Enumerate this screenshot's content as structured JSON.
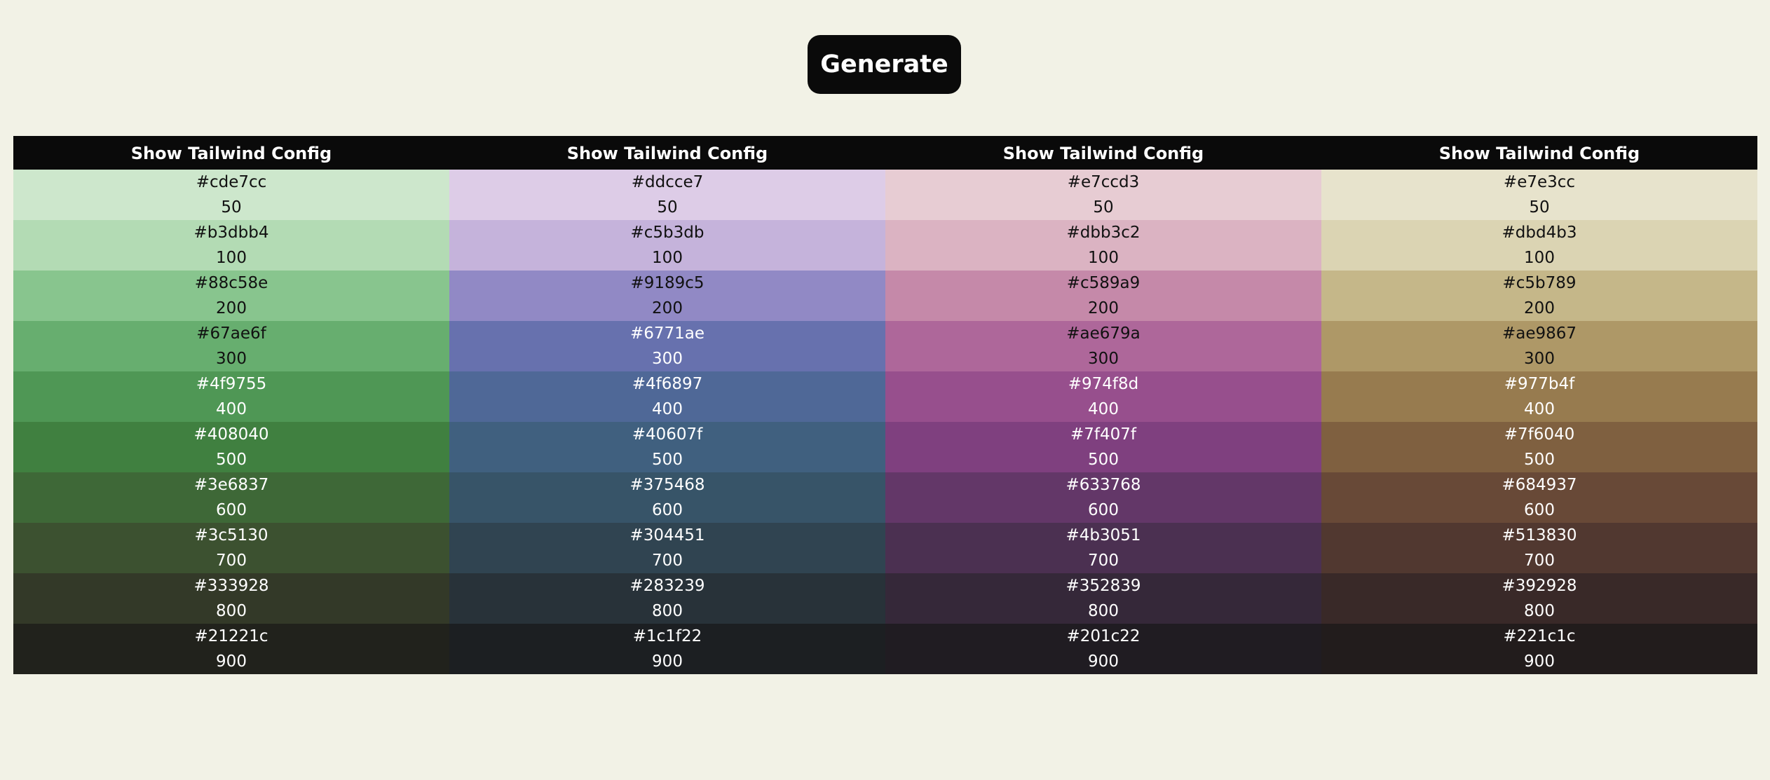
{
  "generate_label": "Generate",
  "palettes": [
    {
      "config_label": "Show Tailwind Config",
      "swatches": [
        {
          "hex": "#cde7cc",
          "shade": "50",
          "text": "#111111"
        },
        {
          "hex": "#b3dbb4",
          "shade": "100",
          "text": "#111111"
        },
        {
          "hex": "#88c58e",
          "shade": "200",
          "text": "#111111"
        },
        {
          "hex": "#67ae6f",
          "shade": "300",
          "text": "#111111"
        },
        {
          "hex": "#4f9755",
          "shade": "400",
          "text": "#ffffff"
        },
        {
          "hex": "#408040",
          "shade": "500",
          "text": "#ffffff"
        },
        {
          "hex": "#3e6837",
          "shade": "600",
          "text": "#ffffff"
        },
        {
          "hex": "#3c5130",
          "shade": "700",
          "text": "#ffffff"
        },
        {
          "hex": "#333928",
          "shade": "800",
          "text": "#ffffff"
        },
        {
          "hex": "#21221c",
          "shade": "900",
          "text": "#ffffff"
        }
      ]
    },
    {
      "config_label": "Show Tailwind Config",
      "swatches": [
        {
          "hex": "#ddcce7",
          "shade": "50",
          "text": "#111111"
        },
        {
          "hex": "#c5b3db",
          "shade": "100",
          "text": "#111111"
        },
        {
          "hex": "#9189c5",
          "shade": "200",
          "text": "#111111"
        },
        {
          "hex": "#6771ae",
          "shade": "300",
          "text": "#ffffff"
        },
        {
          "hex": "#4f6897",
          "shade": "400",
          "text": "#ffffff"
        },
        {
          "hex": "#40607f",
          "shade": "500",
          "text": "#ffffff"
        },
        {
          "hex": "#375468",
          "shade": "600",
          "text": "#ffffff"
        },
        {
          "hex": "#304451",
          "shade": "700",
          "text": "#ffffff"
        },
        {
          "hex": "#283239",
          "shade": "800",
          "text": "#ffffff"
        },
        {
          "hex": "#1c1f22",
          "shade": "900",
          "text": "#ffffff"
        }
      ]
    },
    {
      "config_label": "Show Tailwind Config",
      "swatches": [
        {
          "hex": "#e7ccd3",
          "shade": "50",
          "text": "#111111"
        },
        {
          "hex": "#dbb3c2",
          "shade": "100",
          "text": "#111111"
        },
        {
          "hex": "#c589a9",
          "shade": "200",
          "text": "#111111"
        },
        {
          "hex": "#ae679a",
          "shade": "300",
          "text": "#111111"
        },
        {
          "hex": "#974f8d",
          "shade": "400",
          "text": "#ffffff"
        },
        {
          "hex": "#7f407f",
          "shade": "500",
          "text": "#ffffff"
        },
        {
          "hex": "#633768",
          "shade": "600",
          "text": "#ffffff"
        },
        {
          "hex": "#4b3051",
          "shade": "700",
          "text": "#ffffff"
        },
        {
          "hex": "#352839",
          "shade": "800",
          "text": "#ffffff"
        },
        {
          "hex": "#201c22",
          "shade": "900",
          "text": "#ffffff"
        }
      ]
    },
    {
      "config_label": "Show Tailwind Config",
      "swatches": [
        {
          "hex": "#e7e3cc",
          "shade": "50",
          "text": "#111111"
        },
        {
          "hex": "#dbd4b3",
          "shade": "100",
          "text": "#111111"
        },
        {
          "hex": "#c5b789",
          "shade": "200",
          "text": "#111111"
        },
        {
          "hex": "#ae9867",
          "shade": "300",
          "text": "#111111"
        },
        {
          "hex": "#977b4f",
          "shade": "400",
          "text": "#ffffff"
        },
        {
          "hex": "#7f6040",
          "shade": "500",
          "text": "#ffffff"
        },
        {
          "hex": "#684937",
          "shade": "600",
          "text": "#ffffff"
        },
        {
          "hex": "#513830",
          "shade": "700",
          "text": "#ffffff"
        },
        {
          "hex": "#392928",
          "shade": "800",
          "text": "#ffffff"
        },
        {
          "hex": "#221c1c",
          "shade": "900",
          "text": "#ffffff"
        }
      ]
    }
  ]
}
